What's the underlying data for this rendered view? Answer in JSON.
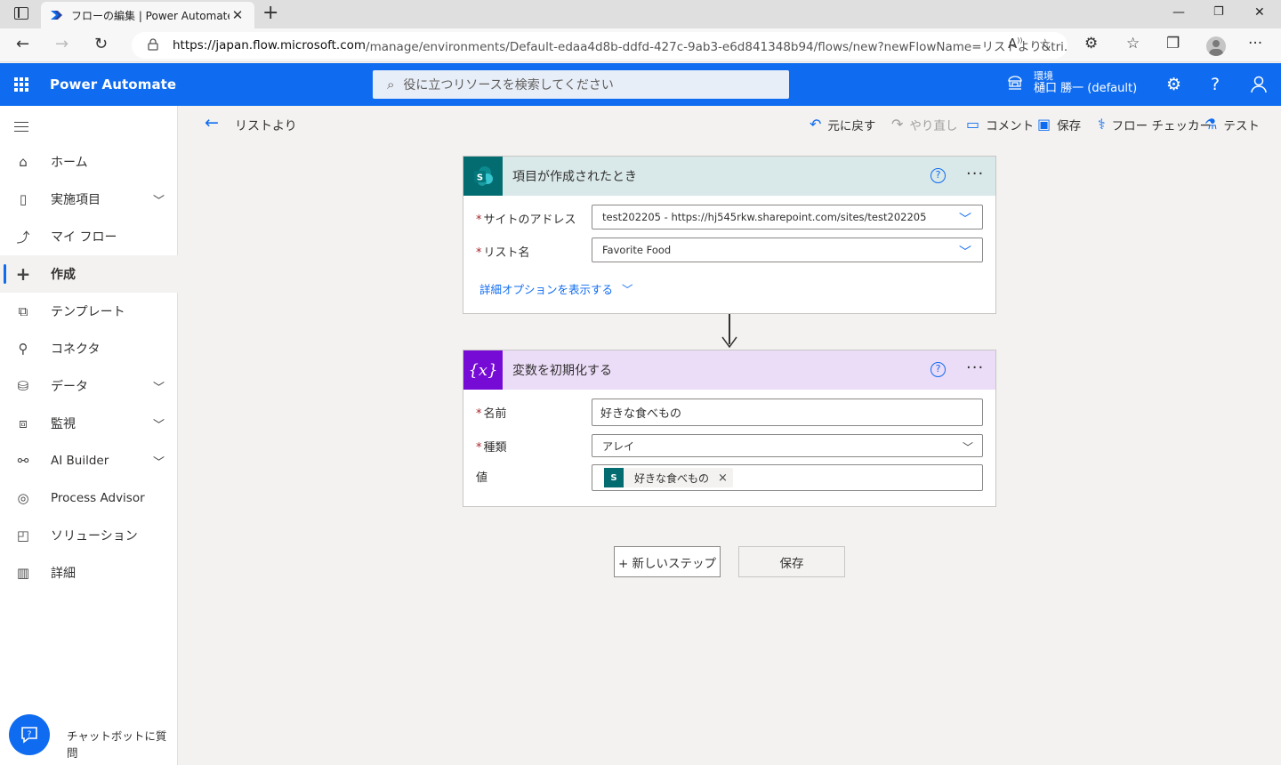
{
  "browser": {
    "tab_title": "フローの編集 | Power Automate",
    "url_host": "https://japan.flow.microsoft.com",
    "url_rest": "/manage/environments/Default-edaa4d8b-ddfd-427c-9ab3-e6d841348b94/flows/new?newFlowName=リストより&tri...",
    "aa_label": "A"
  },
  "app": {
    "name": "Power Automate",
    "search_placeholder": "役に立つリソースを検索してください",
    "env_label": "環境",
    "env_name": "樋口 勝一 (default)"
  },
  "sidebar": {
    "items": [
      {
        "label": "ホーム",
        "icon": "home-icon"
      },
      {
        "label": "実施項目",
        "icon": "clipboard-icon"
      },
      {
        "label": "マイ フロー",
        "icon": "flow-icon"
      },
      {
        "label": "作成",
        "icon": "plus-icon"
      },
      {
        "label": "テンプレート",
        "icon": "template-icon"
      },
      {
        "label": "コネクタ",
        "icon": "connector-icon"
      },
      {
        "label": "データ",
        "icon": "database-icon"
      },
      {
        "label": "監視",
        "icon": "monitor-icon"
      },
      {
        "label": "AI Builder",
        "icon": "ai-builder-icon"
      },
      {
        "label": "Process Advisor",
        "icon": "process-advisor-icon"
      },
      {
        "label": "ソリューション",
        "icon": "solution-icon"
      },
      {
        "label": "詳細",
        "icon": "book-icon"
      }
    ],
    "chatbot_label": "チャットボットに質問"
  },
  "commandbar": {
    "flow_name": "リストより",
    "undo": "元に戻す",
    "redo": "やり直し",
    "comment": "コメント",
    "save": "保存",
    "checker": "フロー チェッカー",
    "test": "テスト"
  },
  "trigger": {
    "title": "項目が作成されたとき",
    "site_label": "サイトのアドレス",
    "site_value": "test202205 - https://hj545rkw.sharepoint.com/sites/test202205",
    "list_label": "リスト名",
    "list_value": "Favorite Food",
    "advanced_link": "詳細オプションを表示する",
    "icon_letter": "S",
    "accent": "#036c70"
  },
  "action": {
    "title": "変数を初期化する",
    "icon_text": "{x}",
    "accent": "#770bd6",
    "name_label": "名前",
    "name_value": "好きな食べもの",
    "type_label": "種類",
    "type_value": "アレイ",
    "value_label": "値",
    "token_label": "好きな食べもの",
    "token_remove": "×"
  },
  "buttons": {
    "new_step": "+ 新しいステップ",
    "save": "保存"
  }
}
